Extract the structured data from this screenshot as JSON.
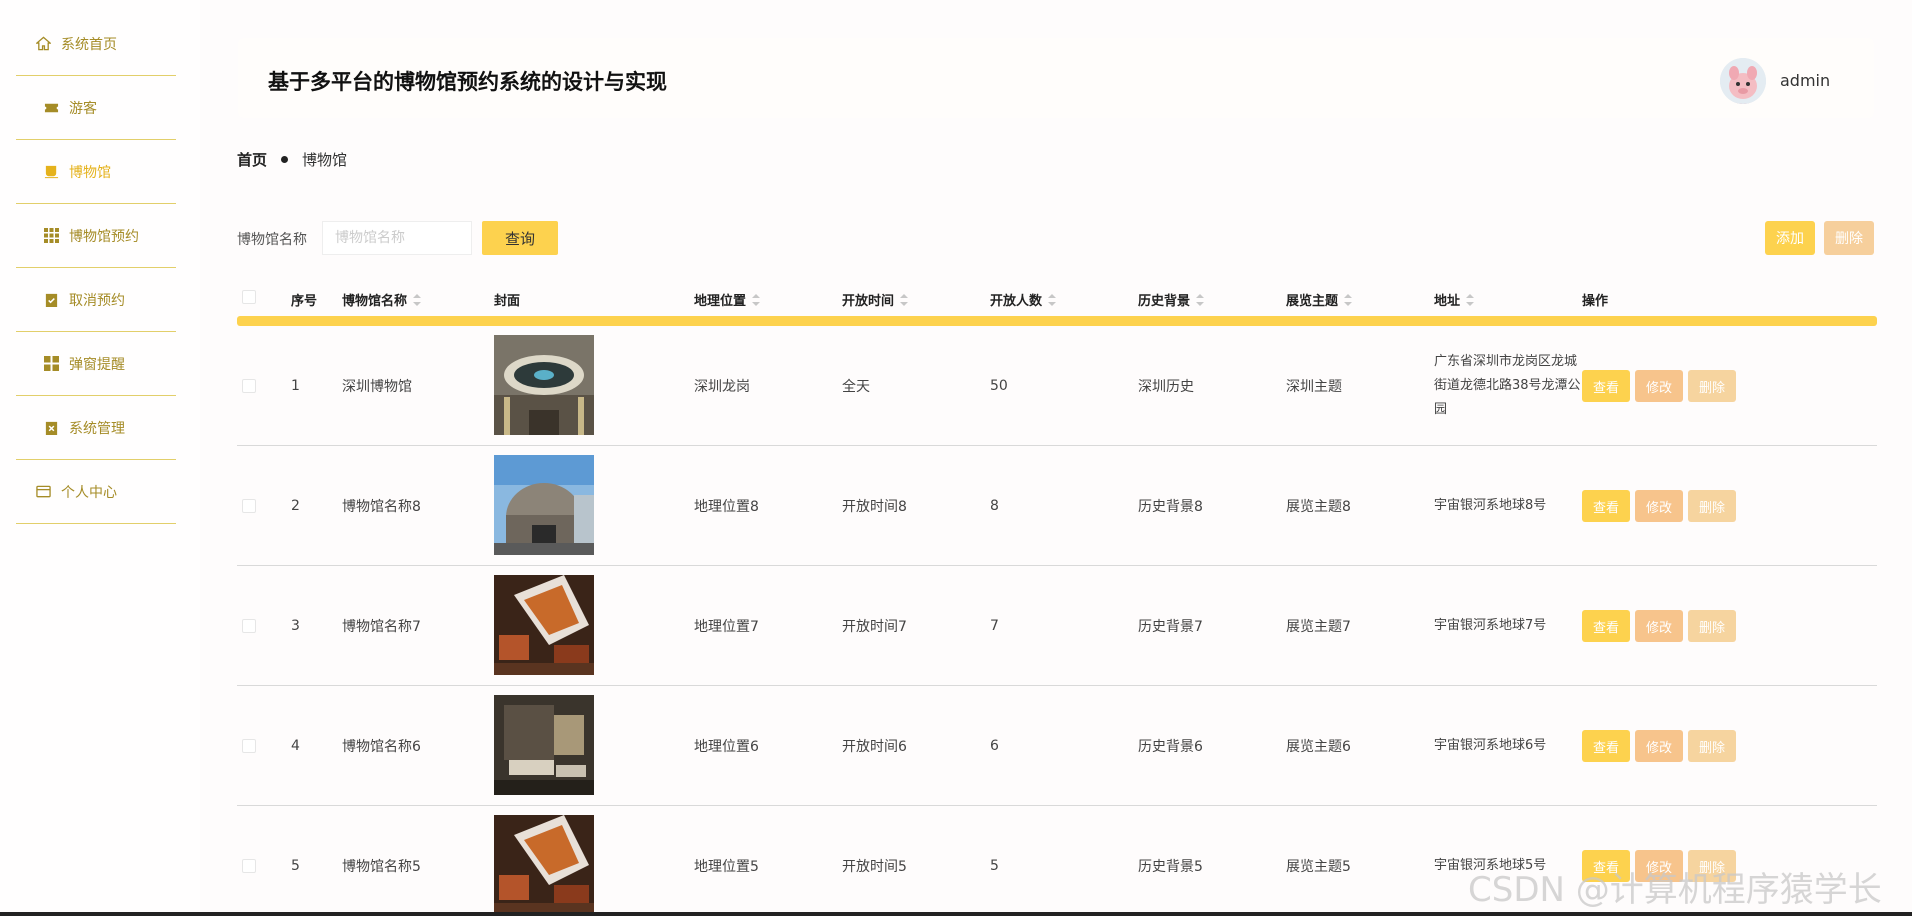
{
  "sidebar": {
    "items": [
      {
        "label": "系统首页",
        "icon": "home-icon"
      },
      {
        "label": "游客",
        "icon": "ticket-icon"
      },
      {
        "label": "博物馆",
        "icon": "cup-icon",
        "active": true
      },
      {
        "label": "博物馆预约",
        "icon": "grid-icon"
      },
      {
        "label": "取消预约",
        "icon": "clipboard-check-icon"
      },
      {
        "label": "弹窗提醒",
        "icon": "apps-icon"
      },
      {
        "label": "系统管理",
        "icon": "clipboard-x-icon"
      },
      {
        "label": "个人中心",
        "icon": "card-icon"
      }
    ]
  },
  "header": {
    "title": "基于多平台的博物馆预约系统的设计与实现",
    "username": "admin"
  },
  "breadcrumb": {
    "home": "首页",
    "current": "博物馆"
  },
  "search": {
    "label": "博物馆名称",
    "placeholder": "博物馆名称",
    "query_label": "查询"
  },
  "toolbar": {
    "add_label": "添加",
    "delete_label": "删除"
  },
  "table": {
    "columns": {
      "index": "序号",
      "name": "博物馆名称",
      "cover": "封面",
      "location": "地理位置",
      "hours": "开放时间",
      "capacity": "开放人数",
      "history": "历史背景",
      "theme": "展览主题",
      "address": "地址",
      "actions": "操作"
    },
    "action_labels": {
      "view": "查看",
      "edit": "修改",
      "delete": "删除"
    },
    "rows": [
      {
        "index": "1",
        "name": "深圳博物馆",
        "location": "深圳龙岗",
        "hours": "全天",
        "capacity": "50",
        "history": "深圳历史",
        "theme": "深圳主题",
        "address": "广东省深圳市龙岗区龙城街道龙德北路38号龙潭公园",
        "cover": "dome-hall"
      },
      {
        "index": "2",
        "name": "博物馆名称8",
        "location": "地理位置8",
        "hours": "开放时间8",
        "capacity": "8",
        "history": "历史背景8",
        "theme": "展览主题8",
        "address": "宇宙银河系地球8号",
        "cover": "round-building"
      },
      {
        "index": "3",
        "name": "博物馆名称7",
        "location": "地理位置7",
        "hours": "开放时间7",
        "capacity": "7",
        "history": "历史背景7",
        "theme": "展览主题7",
        "address": "宇宙银河系地球7号",
        "cover": "exhibit-orange"
      },
      {
        "index": "4",
        "name": "博物馆名称6",
        "location": "地理位置6",
        "hours": "开放时间6",
        "capacity": "6",
        "history": "历史背景6",
        "theme": "展览主题6",
        "address": "宇宙银河系地球6号",
        "cover": "dark-gallery"
      },
      {
        "index": "5",
        "name": "博物馆名称5",
        "location": "地理位置5",
        "hours": "开放时间5",
        "capacity": "5",
        "history": "历史背景5",
        "theme": "展览主题5",
        "address": "宇宙银河系地球5号",
        "cover": "exhibit-orange"
      }
    ]
  },
  "watermark": "CSDN @计算机程序猿学长",
  "colors": {
    "accent": "#fdd24e",
    "menu_text": "#a58c27",
    "active_menu": "#e5b21c",
    "edit": "#f7c48c",
    "delete": "#f6d49f"
  }
}
